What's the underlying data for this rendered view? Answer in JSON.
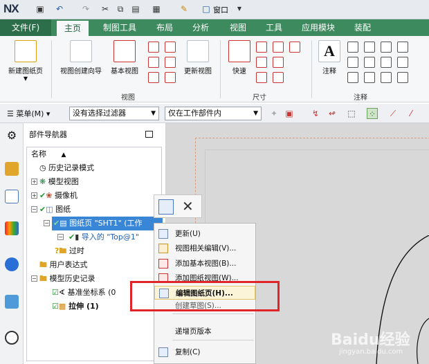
{
  "titlebar": {
    "logo": "NX",
    "window_menu": "窗口"
  },
  "tabs": [
    "文件(F)",
    "主页",
    "制图工具",
    "布局",
    "分析",
    "视图",
    "工具",
    "应用模块",
    "装配"
  ],
  "ribbon": {
    "new_sheet": "新建图纸页",
    "view_wizard": "视图创建向导",
    "base_view": "基本视图",
    "update_view": "更新视图",
    "quick": "快速",
    "note": "注释",
    "groups": {
      "view": "视图",
      "dimension": "尺寸",
      "annotation": "注释"
    }
  },
  "filterbar": {
    "menu": "菜单(M)",
    "filter": "没有选择过滤器",
    "scope": "仅在工作部件内"
  },
  "navigator": {
    "title": "部件导航器",
    "column_name": "名称",
    "items": [
      {
        "label": "历史记录模式"
      },
      {
        "label": "模型视图"
      },
      {
        "label": "摄像机"
      },
      {
        "label": "图纸"
      },
      {
        "label": "图纸页 \"SHT1\" (工作"
      },
      {
        "label": "导入的 \"Top@1\""
      },
      {
        "label": "过时"
      },
      {
        "label": "用户表达式"
      },
      {
        "label": "模型历史记录"
      },
      {
        "label": "基准坐标系 (0"
      },
      {
        "label": "拉伸 (1)"
      }
    ]
  },
  "context_menu": {
    "items": [
      {
        "label": "更新(U)"
      },
      {
        "label": "视图相关编辑(V)..."
      },
      {
        "label": "添加基本视图(B)..."
      },
      {
        "label": "添加图纸视图(W)..."
      },
      {
        "label": "编辑图纸页(H)..."
      },
      {
        "label": "创建草图(S)..."
      },
      {
        "label": "递增页版本"
      },
      {
        "label": "复制(C)"
      }
    ]
  },
  "watermark": {
    "brand": "Baidu经验",
    "url": "jingyan.baidu.com"
  },
  "colors": {
    "tab_bar": "#3d8a5f",
    "highlight": "#fbf4d9",
    "callout": "#e0252a"
  }
}
